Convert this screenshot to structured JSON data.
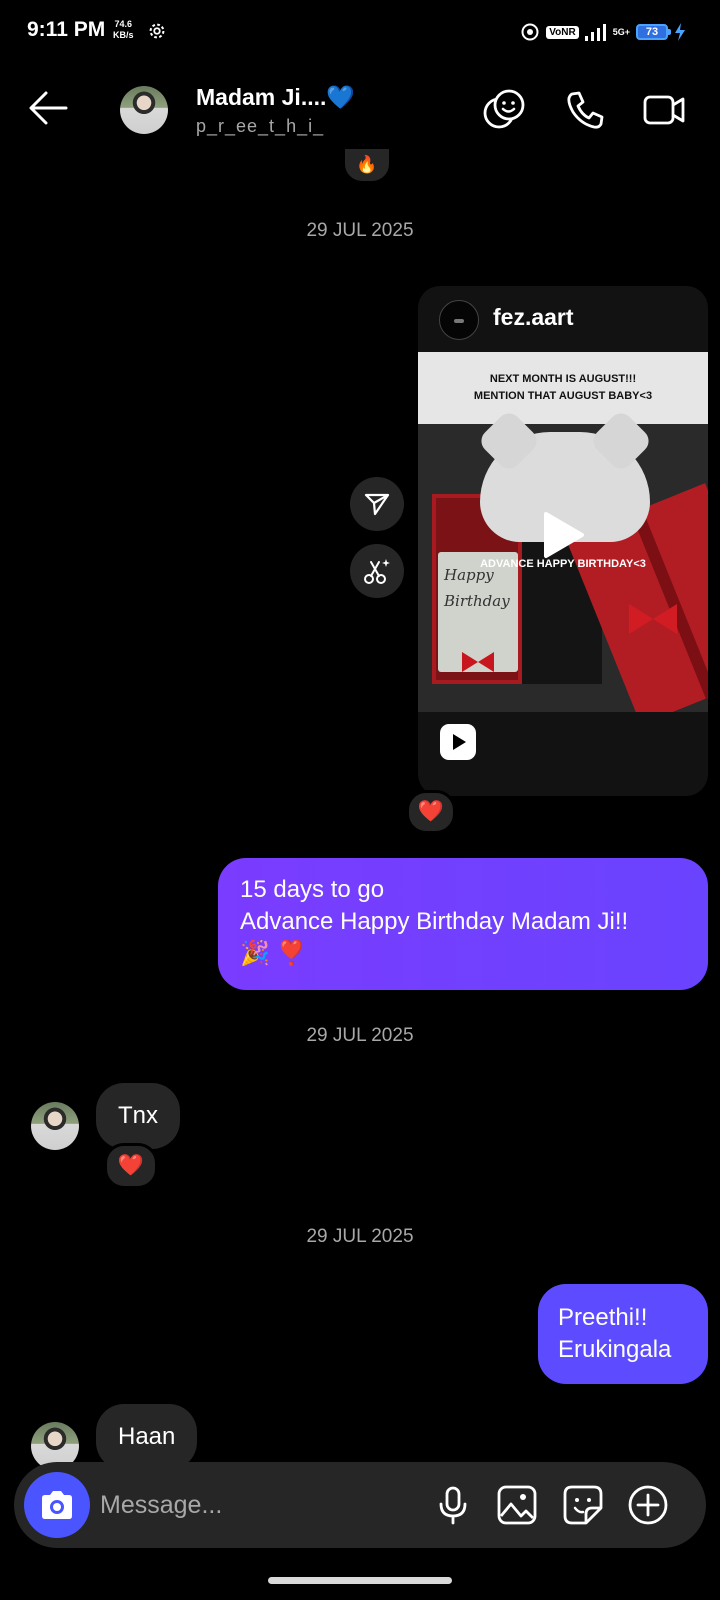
{
  "status_bar": {
    "time": "9:11 PM",
    "speed_value": "74.6",
    "speed_unit": "KB/s",
    "volte": "VoNR",
    "network": "5G+",
    "battery": "73"
  },
  "header": {
    "contact_name": "Madam Ji....💙",
    "contact_handle": "p_r_ee_t_h_i_"
  },
  "messages": {
    "top_reaction": "🔥",
    "date_1": "29 JUL 2025",
    "shared_post": {
      "owner": "fez.aart",
      "banner_line_1": "NEXT MONTH IS AUGUST!!!",
      "banner_line_2": "MENTION THAT AUGUST BABY<3",
      "caption": "ADVANCE HAPPY BIRTHDAY<3",
      "card_text_1": "Happy",
      "card_text_2": "Birthday",
      "reaction": "❤️"
    },
    "sent_1_line_1": "15 days to go",
    "sent_1_line_2": "Advance Happy Birthday Madam Ji!!",
    "sent_1_line_3": "🎉 ❣️",
    "date_2": "29 JUL 2025",
    "recv_1": "Tnx",
    "recv_1_reaction": "❤️",
    "date_3": "29 JUL 2025",
    "sent_2_line_1": "Preethi!!",
    "sent_2_line_2": "Erukingala",
    "recv_2": "Haan"
  },
  "composer": {
    "placeholder": "Message..."
  },
  "colors": {
    "background": "#000000",
    "sent_bubble": "#7a3cff",
    "received_bubble": "#262626",
    "camera_button": "#4a55ff"
  },
  "icons": {
    "back": "arrow-left-icon",
    "sticker_header": "smiley-pair-icon",
    "call": "phone-icon",
    "video": "video-camera-icon",
    "share": "paper-plane-icon",
    "remix": "scissors-sparkle-icon",
    "camera": "camera-icon",
    "mic": "microphone-icon",
    "gallery": "image-icon",
    "sticker": "sticker-icon",
    "more": "plus-circle-icon"
  }
}
